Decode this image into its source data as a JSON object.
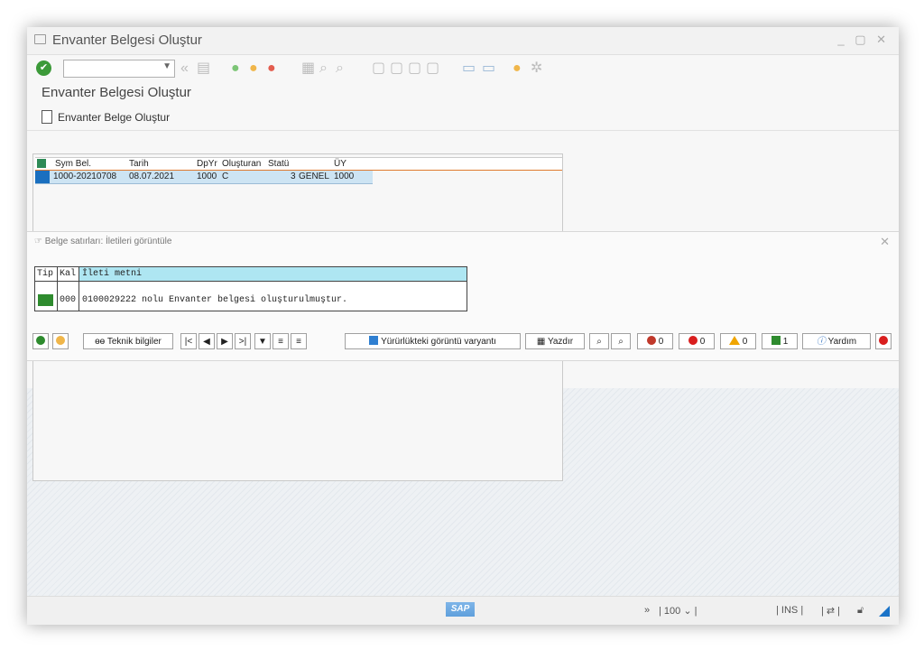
{
  "window": {
    "title": "Envanter Belgesi Oluştur",
    "controls": "_ ▢ ✕"
  },
  "toolbar": {
    "command_value": ""
  },
  "page": {
    "title": "Envanter Belgesi Oluştur"
  },
  "app_toolbar": {
    "create_label": "Envanter Belge Oluştur"
  },
  "grid": {
    "headers": [
      "Sym Bel.",
      "Tarih",
      "DpYr",
      "Oluşturan",
      "Statü",
      "",
      "ÜY"
    ],
    "rows": [
      {
        "sym_bel": "1000-20210708",
        "tarih": "08.07.2021",
        "dpyr": "1000",
        "olusturan": "C",
        "statu": "3",
        "statu_text": "GENEL",
        "uy": "1000"
      }
    ]
  },
  "popup": {
    "title": "Belge satırları: İletileri görüntüle",
    "headers": [
      "Tip",
      "Kal",
      "İleti metni"
    ],
    "message": {
      "kal": "000",
      "text": "0100029222 nolu Envanter belgesi oluşturulmuştur."
    },
    "buttons": {
      "technical": "Teknik bilgiler",
      "variant": "Yürürlükteki görüntü varyantı",
      "print": "Yazdır",
      "stop_count": "0",
      "error_count": "0",
      "warning_count": "0",
      "success_count": "1",
      "help": "Yardım"
    }
  },
  "statusbar": {
    "logo": "SAP",
    "zoom": "100",
    "mode": "INS"
  },
  "colors": {
    "selection": "#1a6fbf",
    "success": "#2e8b2e",
    "header_highlight": "#aee6f2",
    "accent": "#1a73c8"
  }
}
